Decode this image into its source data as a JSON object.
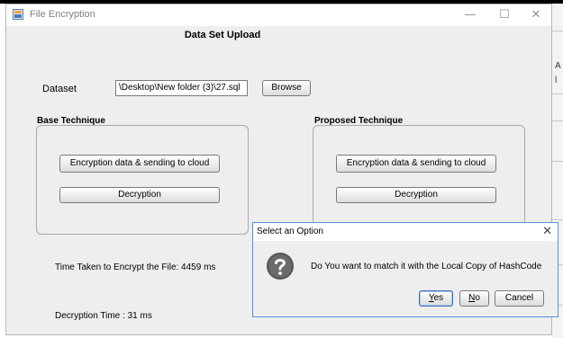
{
  "window": {
    "title": "File Encryption",
    "controls": {
      "minimize": "—",
      "maximize": "☐",
      "close": "✕"
    }
  },
  "main": {
    "heading": "Data Set Upload",
    "dataset_label": "Dataset",
    "dataset_value": "\\Desktop\\New folder (3)\\27.sql",
    "browse_label": "Browse",
    "base": {
      "title": "Base Technique",
      "encrypt_label": "Encryption data & sending to cloud",
      "decrypt_label": "Decryption"
    },
    "proposed": {
      "title": "Proposed Technique",
      "encrypt_label": "Encryption data & sending to cloud",
      "decrypt_label": "Decryption"
    },
    "time_encrypt": "Time Taken to Encrypt the File: 4459 ms",
    "decryption_time": "Decryption Time  : 31 ms"
  },
  "dialog": {
    "title": "Select an Option",
    "close": "✕",
    "message": "Do You want to match it with the Local Copy of HashCode",
    "yes_mnemonic": "Y",
    "yes_rest": "es",
    "no_mnemonic": "N",
    "no_rest": "o",
    "cancel_label": "Cancel"
  },
  "background_edge": {
    "glyph_a": "A",
    "glyph_b": "l"
  },
  "colors": {
    "window_bg": "#eeeeee",
    "dialog_border": "#5b8fd6",
    "question_icon": "#555555"
  }
}
